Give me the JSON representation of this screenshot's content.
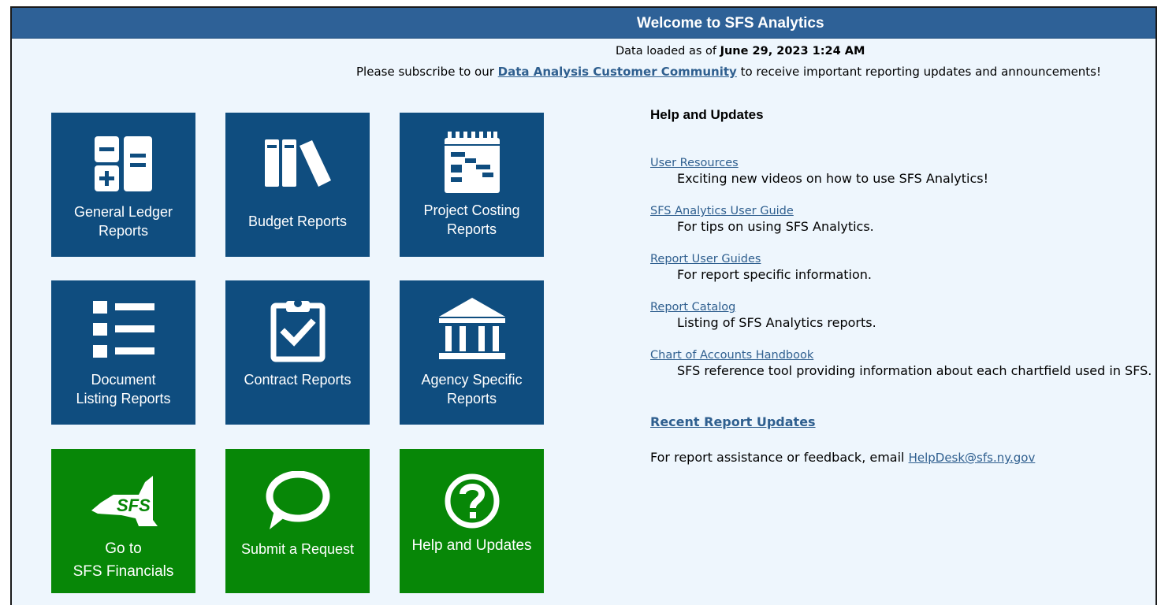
{
  "banner": {
    "title": "Welcome to SFS Analytics"
  },
  "data_loaded": {
    "prefix": "Data loaded as of ",
    "datetime": "June 29, 2023 1:24 AM"
  },
  "subscribe": {
    "prefix": "Please subscribe to our ",
    "link": "Data Analysis Customer Community",
    "suffix": " to receive important reporting updates and announcements!"
  },
  "tiles": [
    {
      "line1": "General Ledger",
      "line2": "Reports",
      "icon": "calculator-icon",
      "color": "#0f4d7f"
    },
    {
      "line1": "Budget Reports",
      "line2": "",
      "icon": "books-icon",
      "color": "#0f4d7f"
    },
    {
      "line1": "Project Costing",
      "line2": "Reports",
      "icon": "gantt-calendar-icon",
      "color": "#0f4d7f"
    },
    {
      "line1": "Document",
      "line2": "Listing Reports",
      "icon": "list-icon",
      "color": "#0f4d7f"
    },
    {
      "line1": "Contract Reports",
      "line2": "",
      "icon": "clipboard-check-icon",
      "color": "#0f4d7f"
    },
    {
      "line1": "Agency Specific",
      "line2": "Reports",
      "icon": "government-building-icon",
      "color": "#0f4d7f"
    },
    {
      "line1": "Go to",
      "line2": "SFS Financials",
      "icon": "sfs-state-logo-icon",
      "logo_text": "SFS",
      "color": "#078707"
    },
    {
      "line1": "Submit a Request",
      "line2": "",
      "icon": "speech-bubble-icon",
      "color": "#078707"
    },
    {
      "line1": "Help and Updates",
      "line2": "",
      "icon": "question-circle-icon",
      "color": "#078707"
    }
  ],
  "help": {
    "heading": "Help and Updates",
    "resources": [
      {
        "link": "User Resources",
        "desc": "Exciting new videos on how to use SFS Analytics!"
      },
      {
        "link": "SFS Analytics User Guide",
        "desc": "For tips on using SFS Analytics."
      },
      {
        "link": "Report User Guides",
        "desc": "For report specific information."
      },
      {
        "link": "Report Catalog",
        "desc": "Listing of SFS Analytics reports."
      },
      {
        "link": "Chart of Accounts Handbook",
        "desc": "SFS reference tool providing information about each chartfield used in SFS."
      }
    ],
    "recent_updates": "Recent Report Updates",
    "assist_prefix": "For report assistance or feedback, email ",
    "assist_email": "HelpDesk@sfs.ny.gov"
  }
}
